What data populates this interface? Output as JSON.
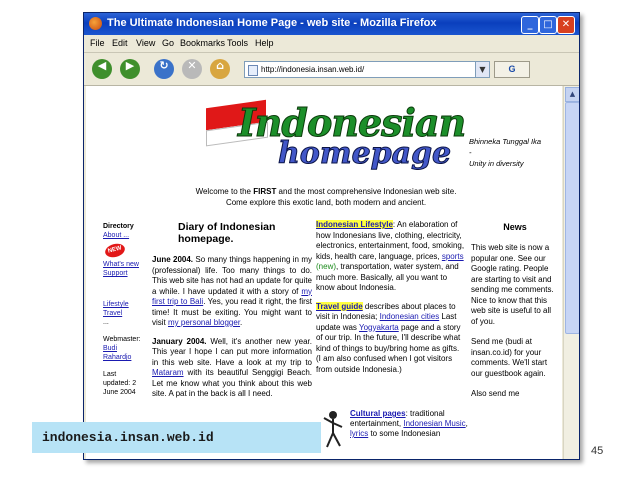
{
  "window": {
    "title": "The Ultimate Indonesian Home Page - web site - Mozilla Firefox",
    "controls": [
      "_",
      "□",
      "✕"
    ]
  },
  "menu": [
    "File",
    "Edit",
    "View",
    "Go",
    "Bookmarks",
    "Tools",
    "Help"
  ],
  "toolbar": {
    "back": "◀",
    "forward": "▶",
    "reload": "↻",
    "stop": "✕",
    "home": "⌂",
    "url": "http://indonesia.insan.web.id/",
    "dropdown": "▼",
    "go": "G"
  },
  "page": {
    "logo": {
      "line1": "Indonesian",
      "line2": "homepage"
    },
    "motto": {
      "line1": "Bhinneka Tunggal Ika",
      "line2": "-",
      "line3": "Unity in diversity"
    },
    "welcome": {
      "line1_pre": "Welcome to the ",
      "line1_bold": "FIRST",
      "line1_post": " and the most comprehensive Indonesian web site.",
      "line2": "Come explore this exotic land, both modern and ancient."
    },
    "left_nav": {
      "directory": "Directory",
      "about": "About ...",
      "new_badge": "NEW",
      "whats_new": "What's new",
      "support": "Support",
      "lifestyle": "Lifestyle",
      "travel": "Travel",
      "dots": "...",
      "webmaster": "Webmaster:",
      "webmaster_name1": "Budi",
      "webmaster_name2": "Rahardjo",
      "last_updated1": "Last",
      "last_updated2": "updated: 2",
      "last_updated3": "June 2004"
    },
    "diary": {
      "title": "Diary of Indonesian homepage.",
      "p1_date": "June 2004.",
      "p1_text": " So many things happening in my (professional) life. Too many things to do. This web site has not had an update for quite a while. I have updated it with a story of ",
      "p1_link1": "my first trip to Bali",
      "p1_text2": ". Yes, you read it right, the first time! It must be exiting. You might want to visit ",
      "p1_link2": "my personal blogger",
      "p1_text3": ".",
      "p2_date": "January 2004.",
      "p2_text": " Well, it's another new year. This year I hope I can put more information in this web site. Have a look at my trip to ",
      "p2_link": "Mataram",
      "p2_text2": " with its beautiful Senggigi Beach. Let me know what you think about this web site. A pat in the back is all I need."
    },
    "middle": {
      "lifestyle_title": "Indonesian Lifestyle",
      "lifestyle_text": ": An elaboration of how Indonesians live, clothing, electricity, electronics, entertainment, food, smoking, kids, health care, language, prices, ",
      "lifestyle_link": "sports",
      "lifestyle_new": " (new)",
      "lifestyle_text2": ", transportation, water system, and much more. Basically, all you want to know about Indonesia.",
      "travel_title": "Travel guide",
      "travel_text": " describes about places to visit in Indonesia; ",
      "travel_link1": "Indonesian cities",
      "travel_text2": " Last update was ",
      "travel_link2": "Yogyakarta",
      "travel_text3": " page and a story of our trip. In the future, I'll describe what kind of things to buy/bring home as gifts. (I am also confused when I got visitors from outside Indonesia.)",
      "cultural_title": "Cultural pages",
      "cultural_text": ": traditional entertainment, ",
      "cultural_link1": "Indonesian Music",
      "cultural_sep": ", ",
      "cultural_link2": "lyrics",
      "cultural_text2": " to some Indonesian"
    },
    "news": {
      "title": "News",
      "p1": "This web site is now a popular one. See our Google rating. People are starting to visit and sending me comments. Nice to know that this web site is useful to all of you.",
      "p2": "Send me (budi at insan.co.id) for your comments. We'll start our guestbook again.",
      "p3": "Also send me"
    }
  },
  "slide": {
    "caption": "indonesia.insan.web.id",
    "page_number": "45"
  }
}
